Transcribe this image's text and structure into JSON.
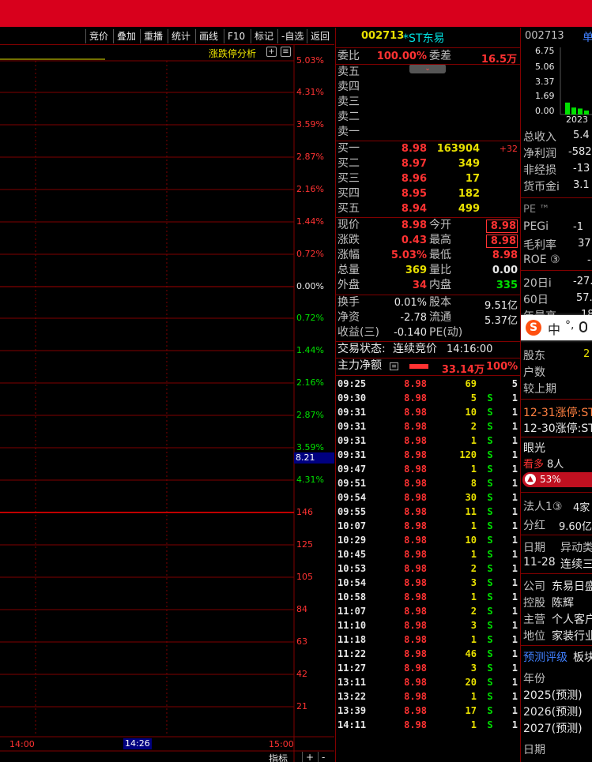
{
  "toolbar": {
    "items": [
      "竞价",
      "叠加",
      "重播",
      "统计",
      "画线",
      "F10",
      "标记",
      "-自选",
      "返回"
    ]
  },
  "chart": {
    "panel_title": "涨跌停分析",
    "pct_labels_up": [
      "5.03%",
      "4.31%",
      "3.59%",
      "2.87%",
      "2.16%",
      "1.44%",
      "0.72%"
    ],
    "pct_zero": "0.00%",
    "pct_labels_down": [
      "0.72%",
      "1.44%",
      "2.16%",
      "2.87%",
      "3.59%",
      "4.31%"
    ],
    "price_marker": "8.21",
    "vol_labels": [
      "146",
      "125",
      "105",
      "84",
      "63",
      "42",
      "21"
    ],
    "time_start": "14:00",
    "time_cursor": "14:26",
    "time_end": "15:00",
    "bottom_tabs": [
      "指标",
      "+",
      "-"
    ],
    "colors": {
      "grid": "#800000",
      "up": "#ff3232",
      "down": "#00e000",
      "price_line": "#e8e000"
    }
  },
  "quote": {
    "code": "002713",
    "name": "*ST东易",
    "weibi_label": "委比",
    "weibi_value": "100.00%",
    "weicha_label": "委差",
    "weicha_value": "16.5万",
    "sell_labels": [
      "卖五",
      "卖四",
      "卖三",
      "卖二",
      "卖一"
    ],
    "buy": [
      {
        "label": "买一",
        "price": "8.98",
        "vol": "163904",
        "chg": "+32"
      },
      {
        "label": "买二",
        "price": "8.97",
        "vol": "349",
        "chg": ""
      },
      {
        "label": "买三",
        "price": "8.96",
        "vol": "17",
        "chg": ""
      },
      {
        "label": "买四",
        "price": "8.95",
        "vol": "182",
        "chg": ""
      },
      {
        "label": "买五",
        "price": "8.94",
        "vol": "499",
        "chg": ""
      }
    ],
    "stats": [
      {
        "l1": "现价",
        "v1": "8.98",
        "l2": "今开",
        "v2": "8.98"
      },
      {
        "l1": "涨跌",
        "v1": "0.43",
        "l2": "最高",
        "v2": "8.98"
      },
      {
        "l1": "涨幅",
        "v1": "5.03%",
        "l2": "最低",
        "v2": "8.98"
      },
      {
        "l1": "总量",
        "v1": "369",
        "l2": "量比",
        "v2": "0.00"
      },
      {
        "l1": "外盘",
        "v1": "34",
        "l2": "内盘",
        "v2": "335"
      }
    ],
    "fin": [
      {
        "l1": "换手",
        "v1": "0.01%",
        "l2": "股本",
        "v2": "9.51亿"
      },
      {
        "l1": "净资",
        "v1": "-2.78",
        "l2": "流通",
        "v2": "5.37亿"
      },
      {
        "l1": "收益(三)",
        "v1": "-0.140",
        "l2": "PE(动)",
        "v2": ""
      }
    ],
    "status_label": "交易状态:",
    "status_value": "连续竞价",
    "status_time": "14:16:00",
    "main_net_label": "主力净额",
    "main_net_value": "33.14万",
    "main_net_pct": "100%"
  },
  "ticks": [
    {
      "t": "09:25",
      "p": "8.98",
      "v": "69",
      "s": "",
      "n": "5"
    },
    {
      "t": "09:30",
      "p": "8.98",
      "v": "5",
      "s": "S",
      "n": "1"
    },
    {
      "t": "09:31",
      "p": "8.98",
      "v": "10",
      "s": "S",
      "n": "1"
    },
    {
      "t": "09:31",
      "p": "8.98",
      "v": "2",
      "s": "S",
      "n": "1"
    },
    {
      "t": "09:31",
      "p": "8.98",
      "v": "1",
      "s": "S",
      "n": "1"
    },
    {
      "t": "09:31",
      "p": "8.98",
      "v": "120",
      "s": "S",
      "n": "1"
    },
    {
      "t": "09:47",
      "p": "8.98",
      "v": "1",
      "s": "S",
      "n": "1"
    },
    {
      "t": "09:51",
      "p": "8.98",
      "v": "8",
      "s": "S",
      "n": "1"
    },
    {
      "t": "09:54",
      "p": "8.98",
      "v": "30",
      "s": "S",
      "n": "1"
    },
    {
      "t": "09:55",
      "p": "8.98",
      "v": "11",
      "s": "S",
      "n": "1"
    },
    {
      "t": "10:07",
      "p": "8.98",
      "v": "1",
      "s": "S",
      "n": "1"
    },
    {
      "t": "10:29",
      "p": "8.98",
      "v": "10",
      "s": "S",
      "n": "1"
    },
    {
      "t": "10:45",
      "p": "8.98",
      "v": "1",
      "s": "S",
      "n": "1"
    },
    {
      "t": "10:53",
      "p": "8.98",
      "v": "2",
      "s": "S",
      "n": "1"
    },
    {
      "t": "10:54",
      "p": "8.98",
      "v": "3",
      "s": "S",
      "n": "1"
    },
    {
      "t": "10:58",
      "p": "8.98",
      "v": "1",
      "s": "S",
      "n": "1"
    },
    {
      "t": "11:07",
      "p": "8.98",
      "v": "2",
      "s": "S",
      "n": "1"
    },
    {
      "t": "11:10",
      "p": "8.98",
      "v": "3",
      "s": "S",
      "n": "1"
    },
    {
      "t": "11:18",
      "p": "8.98",
      "v": "1",
      "s": "S",
      "n": "1"
    },
    {
      "t": "11:22",
      "p": "8.98",
      "v": "46",
      "s": "S",
      "n": "1"
    },
    {
      "t": "11:27",
      "p": "8.98",
      "v": "3",
      "s": "S",
      "n": "1"
    },
    {
      "t": "13:11",
      "p": "8.98",
      "v": "20",
      "s": "S",
      "n": "1"
    },
    {
      "t": "13:22",
      "p": "8.98",
      "v": "1",
      "s": "S",
      "n": "1"
    },
    {
      "t": "13:39",
      "p": "8.98",
      "v": "17",
      "s": "S",
      "n": "1"
    },
    {
      "t": "14:11",
      "p": "8.98",
      "v": "1",
      "s": "S",
      "n": "1"
    }
  ],
  "right": {
    "code": "002713",
    "tab": "单",
    "bar_axis": [
      "6.75",
      "5.06",
      "3.37",
      "1.69",
      "0.00"
    ],
    "bar_values": [
      1.2,
      0.7,
      0.6,
      0.4
    ],
    "year": "2023",
    "fin_rows": [
      {
        "l": "总收入",
        "v": "5.4"
      },
      {
        "l": "净利润",
        "v": "-582"
      },
      {
        "l": "非经损",
        "v": "-13"
      },
      {
        "l": "货币金i",
        "v": "3.1"
      }
    ],
    "pe_label": "PE ™",
    "ratios": [
      {
        "l": "PEGi",
        "v": "-1"
      },
      {
        "l": "毛利率",
        "v": "37"
      },
      {
        "l": "ROE ③",
        "v": "-"
      }
    ],
    "periods": [
      {
        "l": "20日i",
        "v": "-27."
      },
      {
        "l": "60日",
        "v": "57."
      },
      {
        "l": "年最高",
        "v": "18"
      }
    ],
    "ime": {
      "zh": "中",
      "punct": "°,"
    },
    "holder_rows": [
      {
        "l": "股东",
        "v": "2"
      },
      {
        "l": "户数",
        "v": ""
      },
      {
        "l": "较上期",
        "v": ""
      }
    ],
    "news1": "12-31涨停:ST",
    "news2": "12-30涨停:ST",
    "vision_label": "眼光",
    "bullish": "看多",
    "bullish_count": "8人",
    "bullish_pct": "53%",
    "legal_label": "法人1③",
    "legal_value": "4家",
    "dividend_label": "分红",
    "dividend_value": "9.60亿",
    "date_label": "日期",
    "anomaly_label": "异动类",
    "date_value": "11-28",
    "anomaly_value": "连续三",
    "company_rows": [
      {
        "l": "公司",
        "v": "东易日盛"
      },
      {
        "l": "控股",
        "v": "陈辉"
      },
      {
        "l": "主营",
        "v": "个人客户"
      },
      {
        "l": "地位",
        "v": "家装行业"
      }
    ],
    "forecast_tab": "预测评级",
    "sector_tab": "板块",
    "year_label": "年份",
    "years": [
      "2025(预测)",
      "2026(预测)",
      "2027(预测)"
    ],
    "bottom_label": "日期"
  }
}
